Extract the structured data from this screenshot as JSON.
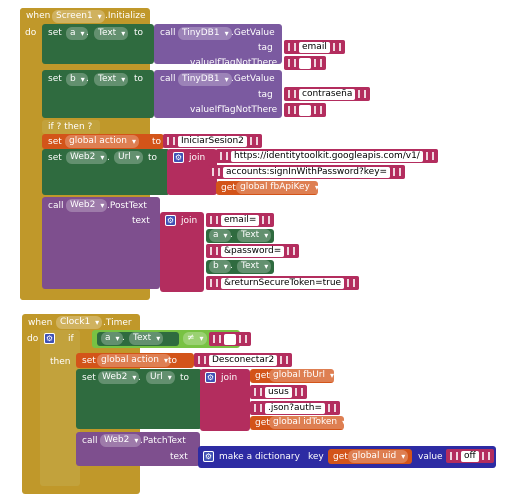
{
  "colors": {
    "event": "#c0982a",
    "var": "#d35419",
    "comp": "#2f6b3f",
    "text": "#b32d5e",
    "tinydb": "#7b5aa0",
    "ctrl": "#c2a23c",
    "web": "#7e4f8e",
    "dict": "#2d2ba3",
    "logic": "#78c243"
  },
  "b1": {
    "when": "when",
    "comp": "Screen1",
    "evt": ".Initialize",
    "do": "do",
    "set_kw": "set",
    "to": "to",
    "a": "a",
    "b": "b",
    "text_prop": "Text",
    "call": "call",
    "tinydb": "TinyDB1",
    "getvalue": ".GetValue",
    "tag": "tag",
    "vitnt": "valueIfTagNotThere",
    "email": "email",
    "contrasena": "contraseña",
    "ifthen": "if ? then ?",
    "set_global_action": "set",
    "global_action": "global action",
    "iniciar": "IniciarSesion2",
    "web2": "Web2",
    "url": "Url",
    "join": "join",
    "s1": "https://identitytoolkit.googleapis.com/v1/",
    "s2": "accounts:signInWithPassword?key=",
    "get": "get",
    "fbapikey": "global fbApiKey",
    "posttext": ".PostText",
    "text": "text",
    "email_eq": "email=",
    "password_eq": "&password=",
    "rst": "&returnSecureToken=true"
  },
  "b2": {
    "when": "when",
    "comp": "Clock1",
    "evt": ".Timer",
    "do": "do",
    "if": "if",
    "then": "then",
    "a": "a",
    "text_prop": "Text",
    "neq": "≠",
    "set": "set",
    "global_action": "global action",
    "to": "to",
    "desconectar": "Desconectar2",
    "web2": "Web2",
    "url": "Url",
    "join": "join",
    "get": "get",
    "fburl": "global fbUrl",
    "usus": "usus",
    "json": ".json?auth=",
    "idtoken": "global idToken",
    "call": "call",
    "patch": ".PatchText",
    "text": "text",
    "make_dict": "make a dictionary",
    "key": "key",
    "uid": "global uid",
    "value": "value",
    "off": "off"
  }
}
